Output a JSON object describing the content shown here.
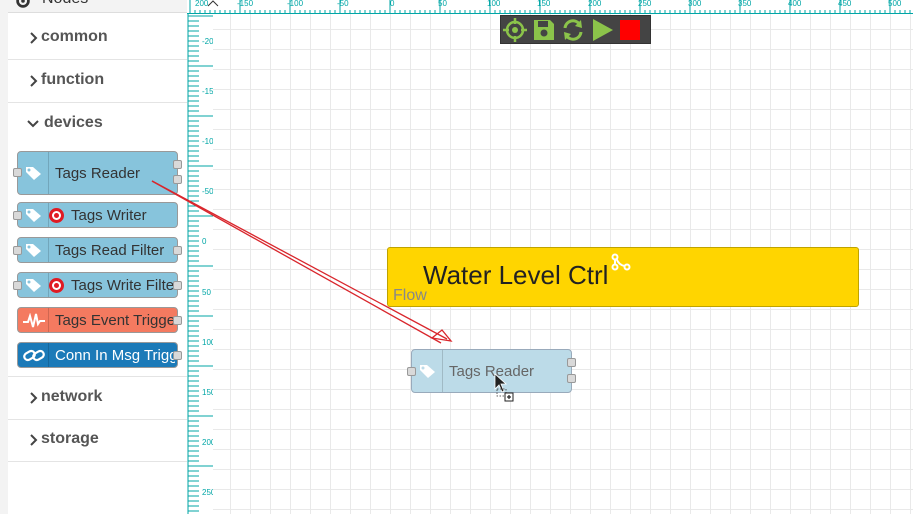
{
  "palette": {
    "header": {
      "title": "Nodes",
      "icon": "gear-icon"
    },
    "categories": [
      {
        "label": "common",
        "expanded": false
      },
      {
        "label": "function",
        "expanded": false
      },
      {
        "label": "devices",
        "expanded": true
      },
      {
        "label": "network",
        "expanded": false
      },
      {
        "label": "storage",
        "expanded": false
      }
    ],
    "device_nodes": [
      {
        "label": "Tags Reader",
        "color": "#87c4dc",
        "icon": "tags-icon"
      },
      {
        "label": "Tags Writer",
        "color": "#87c4dc",
        "icon": "tags-icon",
        "badge": "target-badge-icon"
      },
      {
        "label": "Tags Read Filter",
        "color": "#87c4dc",
        "icon": "tags-icon"
      },
      {
        "label": "Tags Write Filter",
        "color": "#87c4dc",
        "icon": "tags-icon",
        "badge": "target-badge-icon"
      },
      {
        "label": "Tags Event Trigger",
        "color": "#f47a60",
        "icon": "pulse-icon"
      },
      {
        "label": "Conn In Msg Trigger",
        "color": "#1b7ab8",
        "icon": "link-icon"
      }
    ]
  },
  "rulers": {
    "top_labels": [
      "200",
      "-150",
      "-100",
      "-50",
      "0",
      "50",
      "100",
      "150",
      "200",
      "250",
      "300",
      "350",
      "400",
      "450",
      "500"
    ],
    "left_labels": [
      "-200",
      "-150",
      "-100",
      "-50",
      "0",
      "50",
      "100",
      "150",
      "200",
      "250"
    ],
    "color": "#00a6a6"
  },
  "toolbar": {
    "buttons": [
      "crosshair-icon",
      "save-icon",
      "refresh-icon",
      "play-icon",
      "stop-icon"
    ],
    "accent": "#8bc34a",
    "stop_color": "#ff0000"
  },
  "canvas": {
    "group": {
      "title": "Water Level Ctrl",
      "subtitle": "Flow",
      "color": "#ffd500",
      "icon": "branch-icon"
    },
    "dropped_node": {
      "label": "Tags Reader",
      "color": "#bcdbe8",
      "icon": "tags-icon"
    },
    "drag_arrow_color": "#d9262c"
  }
}
